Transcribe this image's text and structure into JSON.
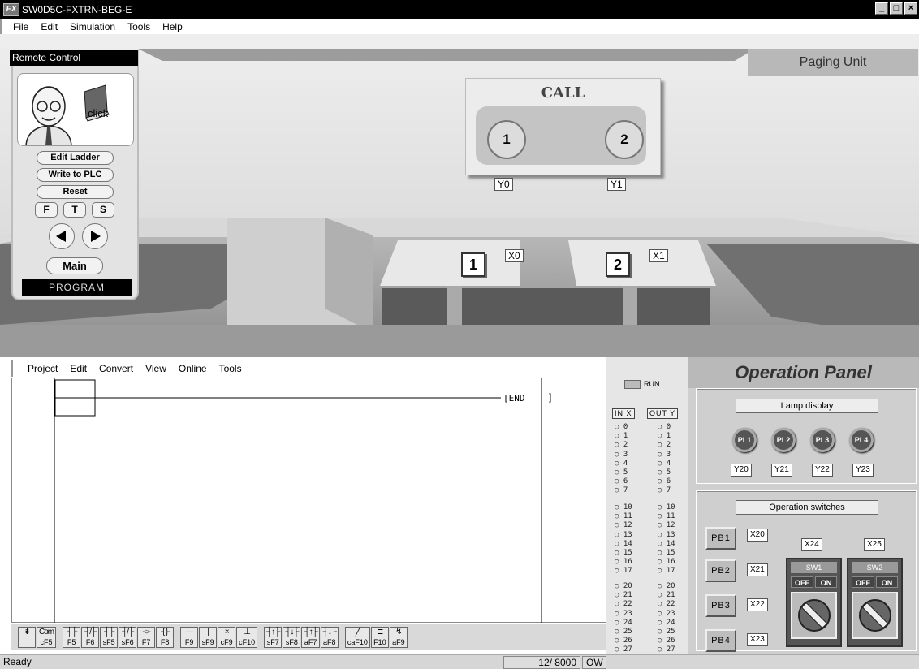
{
  "window": {
    "title": "SW0D5C-FXTRN-BEG-E",
    "minimize": "_",
    "maximize": "□",
    "close": "×"
  },
  "menubar": [
    "File",
    "Edit",
    "Simulation",
    "Tools",
    "Help"
  ],
  "remote": {
    "title": "Remote Control",
    "avatar_caption": "click",
    "buttons": [
      "Edit Ladder",
      "Write to PLC",
      "Reset"
    ],
    "fts": [
      "F",
      "T",
      "S"
    ],
    "main": "Main",
    "mode": "PROGRAM"
  },
  "scene": {
    "paging_unit": "Paging Unit",
    "call_label": "CALL",
    "call_lamps": [
      "1",
      "2"
    ],
    "call_tags": [
      "Y0",
      "Y1"
    ],
    "desk_buttons": [
      "1",
      "2"
    ],
    "desk_tags": [
      "X0",
      "X1"
    ]
  },
  "editor": {
    "menubar": [
      "Project",
      "Edit",
      "Convert",
      "View",
      "Online",
      "Tools"
    ],
    "end_instruction": "[END",
    "toolbar": [
      {
        "sym": "⇟",
        "key": ""
      },
      {
        "sym": "Com",
        "key": "cF5"
      },
      {
        "sym": "┤├",
        "key": "F5"
      },
      {
        "sym": "┤/├",
        "key": "F6"
      },
      {
        "sym": "┤├",
        "key": "sF5"
      },
      {
        "sym": "┤/├",
        "key": "sF6"
      },
      {
        "sym": "-○-",
        "key": "F7"
      },
      {
        "sym": "-{ }-",
        "key": "F8"
      },
      {
        "sym": "—",
        "key": "F9"
      },
      {
        "sym": "|",
        "key": "sF9"
      },
      {
        "sym": "×",
        "key": "cF9"
      },
      {
        "sym": "⊥",
        "key": "cF10"
      },
      {
        "sym": "┤↑├",
        "key": "sF7"
      },
      {
        "sym": "┤↓├",
        "key": "sF8"
      },
      {
        "sym": "┤↑├",
        "key": "aF7"
      },
      {
        "sym": "┤↓├",
        "key": "aF8"
      },
      {
        "sym": "╱",
        "key": "caF10"
      },
      {
        "sym": "⊏",
        "key": "F10"
      },
      {
        "sym": "↯",
        "key": "aF9"
      }
    ]
  },
  "status": {
    "text": "Ready",
    "steps": "12/ 8000",
    "mode": "OW"
  },
  "io": {
    "run_label": "RUN",
    "in_header": "IN X",
    "out_header": "OUT Y",
    "group1": [
      "0",
      "1",
      "2",
      "3",
      "4",
      "5",
      "6",
      "7"
    ],
    "group2": [
      "10",
      "11",
      "12",
      "13",
      "14",
      "15",
      "16",
      "17"
    ],
    "group3": [
      "20",
      "21",
      "22",
      "23",
      "24",
      "25",
      "26",
      "27"
    ]
  },
  "operation_panel": {
    "title": "Operation Panel",
    "lamp_group_label": "Lamp display",
    "lamps": [
      "PL1",
      "PL2",
      "PL3",
      "PL4"
    ],
    "lamp_tags": [
      "Y20",
      "Y21",
      "Y22",
      "Y23"
    ],
    "switch_group_label": "Operation switches",
    "push_buttons": [
      "PB1",
      "PB2",
      "PB3",
      "PB4"
    ],
    "push_tags": [
      "X20",
      "X21",
      "X22",
      "X23"
    ],
    "switch_tags": [
      "X24",
      "X25"
    ],
    "switches": [
      "SW1",
      "SW2"
    ],
    "off_label": "OFF",
    "on_label": "ON"
  }
}
